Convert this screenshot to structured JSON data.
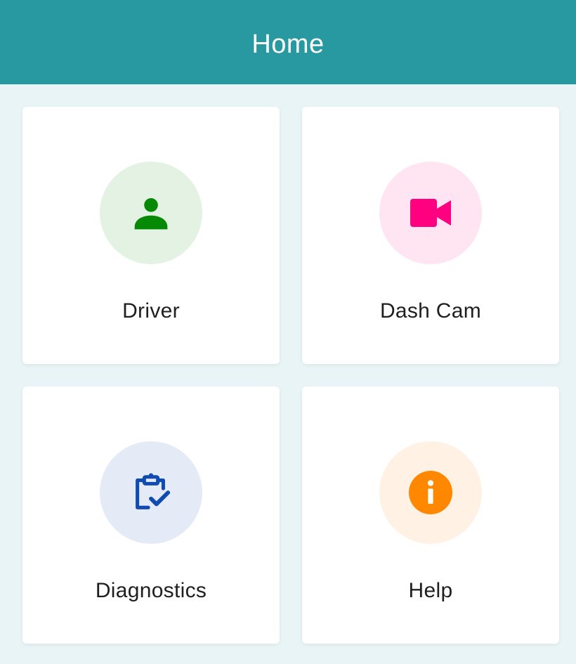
{
  "header": {
    "title": "Home",
    "color": "#2999a1"
  },
  "tiles": [
    {
      "label": "Driver",
      "icon": "person-icon",
      "icon_color": "#068a06",
      "circle_color": "#e4f2e4"
    },
    {
      "label": "Dash Cam",
      "icon": "video-camera-icon",
      "icon_color": "#ff0080",
      "circle_color": "#ffe4f2"
    },
    {
      "label": "Diagnostics",
      "icon": "clipboard-check-icon",
      "icon_color": "#0f4bb0",
      "circle_color": "#e5ebf6"
    },
    {
      "label": "Help",
      "icon": "info-icon",
      "icon_color": "#ff8800",
      "circle_color": "#fff2e5"
    }
  ]
}
